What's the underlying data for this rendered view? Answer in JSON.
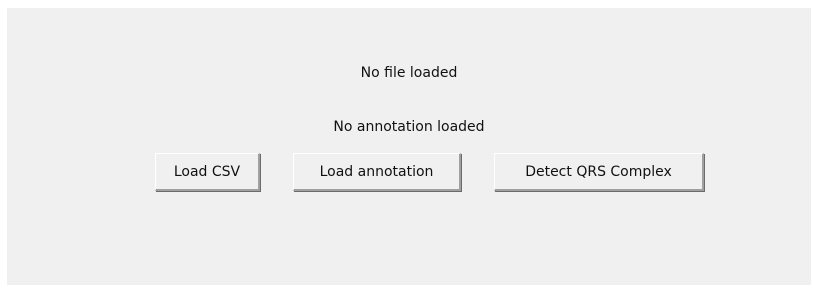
{
  "status": {
    "file": "No file loaded",
    "annotation": "No annotation loaded"
  },
  "buttons": {
    "load_csv": "Load CSV",
    "load_annotation": "Load annotation",
    "detect_qrs": "Detect QRS Complex"
  },
  "colors": {
    "window_background": "#f0f0f0",
    "text": "#111111"
  }
}
